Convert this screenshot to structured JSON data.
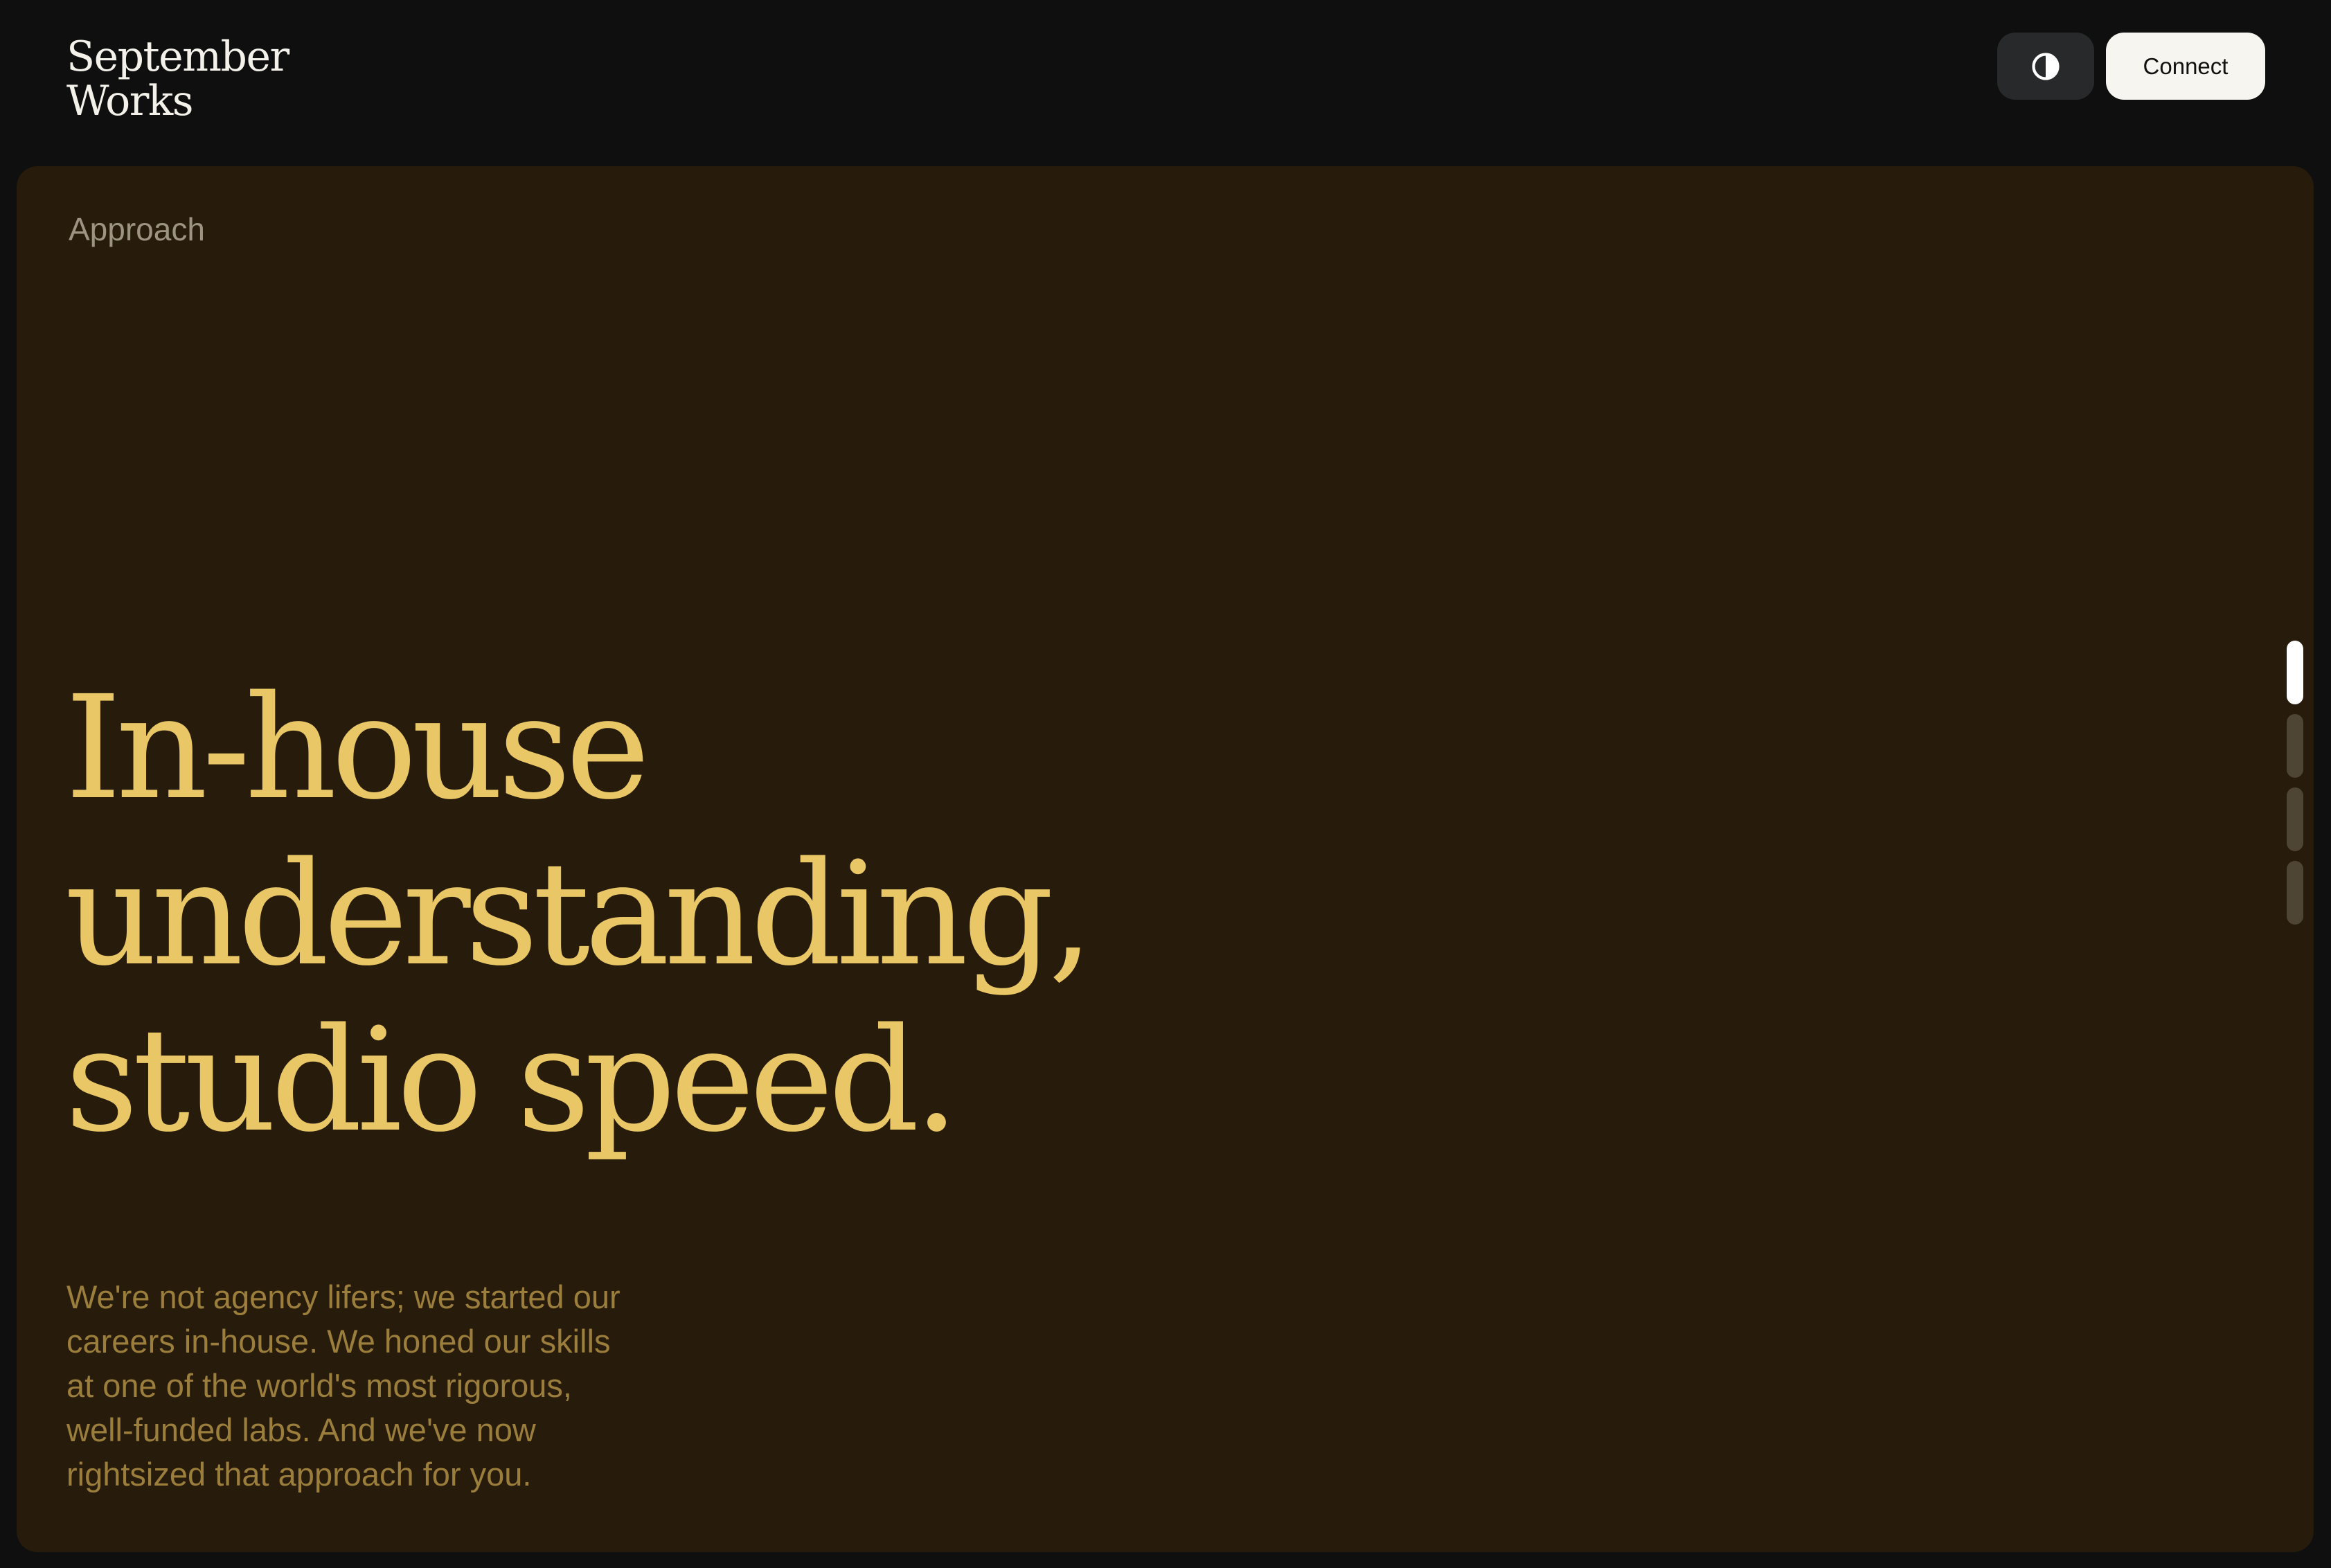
{
  "brand": {
    "line1": "September",
    "line2": "Works"
  },
  "header": {
    "theme_icon": "contrast-half-circle-icon",
    "connect_label": "Connect"
  },
  "section": {
    "label": "Approach",
    "headline_lines": [
      "In-house",
      "understanding,",
      "studio speed."
    ],
    "body_lines": [
      "We're not agency lifers; we started our",
      "careers in-house. We honed our skills",
      "at one of the world's most rigorous,",
      "well-funded labs. And we've now",
      "rightsized that approach for you."
    ]
  },
  "scroll_indicator": {
    "total_sections": 4,
    "active_index": 0
  },
  "colors": {
    "page_background": "#0f0f0f",
    "panel_background": "#271c0b",
    "headline": "#e9c766",
    "body_text": "#9b7d3c",
    "label": "#9c9381",
    "connect_button": "#f6f5ef",
    "theme_toggle": "#28292a"
  }
}
